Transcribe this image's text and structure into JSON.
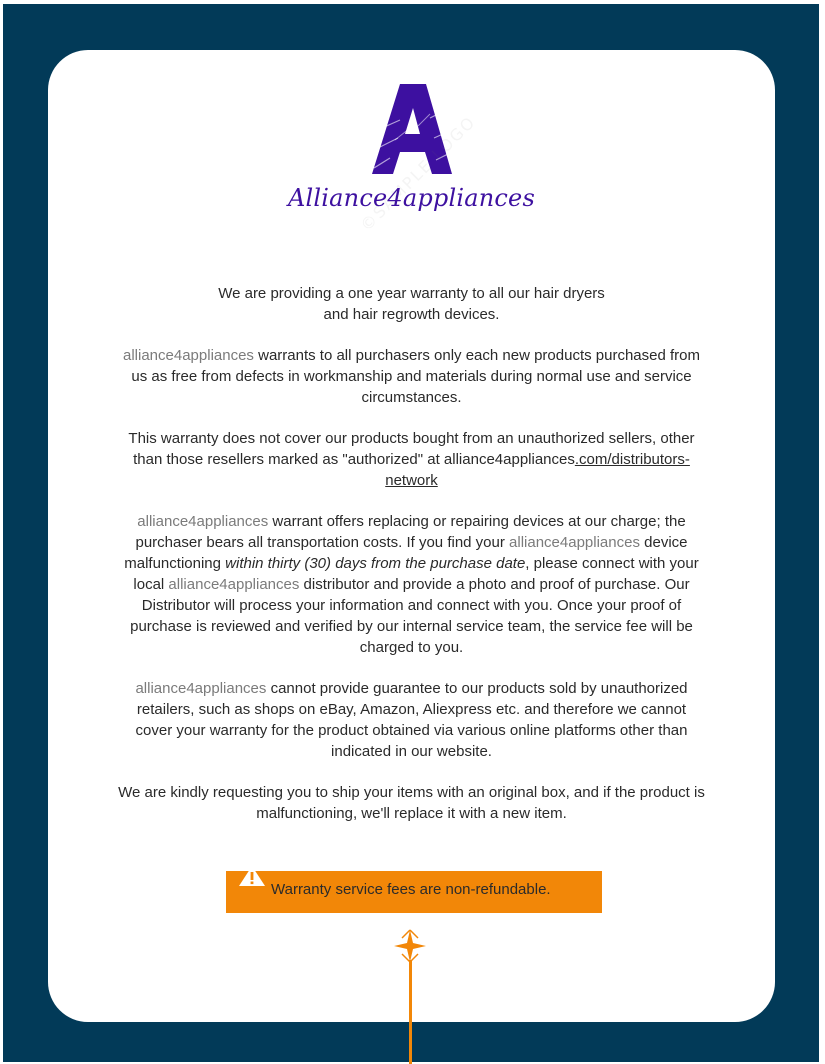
{
  "brand": {
    "name": "Alliance4appliances",
    "watermark": "©SAMPLE LOGO",
    "accent_color": "#3d10a0"
  },
  "content": {
    "p1_line1": "We are providing a one year warranty to all our hair dryers",
    "p1_line2": "and hair regrowth devices.",
    "p2_brand": "alliance4appliances",
    "p2_text": " warrants to all purchasers only each new products purchased from us as free from defects in workmanship and materials during normal use and service circumstances.",
    "p3_text": "This warranty does not cover our products bought from an unauthorized sellers, other than those resellers marked as \"authorized\" at alliance4appliances",
    "p3_link": ".com/distributors-network",
    "p4_brand_a": "alliance4appliances",
    "p4_text_a": " warrant offers replacing or repairing devices at our charge; the purchaser bears all transportation costs. If you find your ",
    "p4_brand_b": "alliance4appliances",
    "p4_text_b": " device malfunctioning ",
    "p4_italic": "within thirty (30) days from the purchase date",
    "p4_text_c": ", please connect with your local ",
    "p4_brand_c": "alliance4appliances",
    "p4_text_d": " distributor and provide a photo and proof of purchase. Our Distributor will process your information and connect with you. Once your proof of purchase is reviewed and verified by our internal service team, the service fee will be charged to you.",
    "p5_brand": "alliance4appliances",
    "p5_text": " cannot provide guarantee to our products sold by unauthorized retailers, such as shops on eBay, Amazon, Aliexpress etc. and therefore we cannot cover your warranty for the product obtained via various online platforms other than indicated in our website.",
    "p6_text": "We are kindly requesting you to ship your items with an original box, and if the product is malfunctioning, we'll replace it with a new item."
  },
  "alert": {
    "icon": "warning-icon",
    "text": "Warranty service fees are non-refundable.",
    "color": "#f28708"
  },
  "decoration": {
    "pin_icon": "sparkle-pin-icon",
    "pin_color": "#f28708"
  }
}
